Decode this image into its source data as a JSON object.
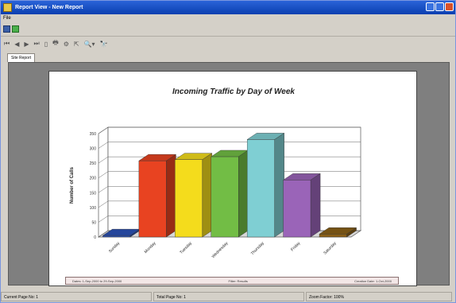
{
  "window": {
    "title": "Report View - New Report"
  },
  "menu": {
    "file": "File"
  },
  "tab": {
    "label": "Site Report"
  },
  "chart_data": {
    "type": "bar",
    "title": "Incoming Traffic by Day of Week",
    "ylabel": "Number of Calls",
    "xlabel": "",
    "ylim": [
      0,
      350
    ],
    "yticks": [
      0,
      50,
      100,
      150,
      200,
      250,
      300,
      350
    ],
    "categories": [
      "Sunday",
      "Monday",
      "Tuesday",
      "Wednesday",
      "Thursday",
      "Friday",
      "Saturday"
    ],
    "values": [
      5,
      258,
      262,
      272,
      330,
      193,
      10
    ],
    "colors": [
      "#2b52b8",
      "#e84321",
      "#f4dc1c",
      "#72bd45",
      "#7fcfd3",
      "#9a64b8",
      "#8a6018"
    ]
  },
  "footer": {
    "dates": "Dates: 1-Sep-2000 to 29-Sep-2000",
    "filter": "Filter: Results",
    "creation": "Creation Date: 1-Oct-2000"
  },
  "status": {
    "current_page": "Current Page No: 1",
    "total_page": "Total Page No: 1",
    "zoom": "Zoom Factor: 100%"
  }
}
